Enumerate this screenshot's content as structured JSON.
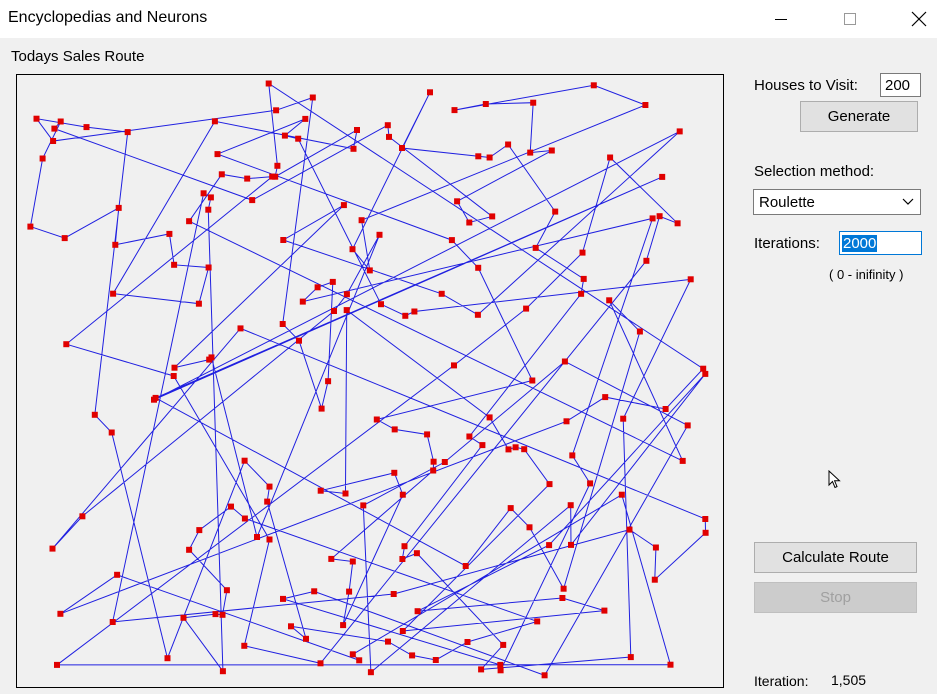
{
  "window": {
    "title": "Encyclopedias and Neurons"
  },
  "route_panel": {
    "label": "Todays Sales Route"
  },
  "controls": {
    "houses_label": "Houses to Visit:",
    "houses_value": "200",
    "generate_label": "Generate",
    "selection_label": "Selection method:",
    "selection_value": "Roulette",
    "iterations_label": "Iterations:",
    "iterations_value": "2000",
    "iterations_hint": "( 0 - inifinity )",
    "calculate_label": "Calculate Route",
    "stop_label": "Stop",
    "iteration_status_label": "Iteration:",
    "iteration_status_value": "1,505"
  },
  "colors": {
    "route_line": "#2020e0",
    "house_marker": "#e00000",
    "accent": "#0078d7"
  },
  "icons": [
    "minimize-icon",
    "maximize-icon",
    "close-icon",
    "chevron-down-icon",
    "mouse-cursor-icon"
  ]
}
